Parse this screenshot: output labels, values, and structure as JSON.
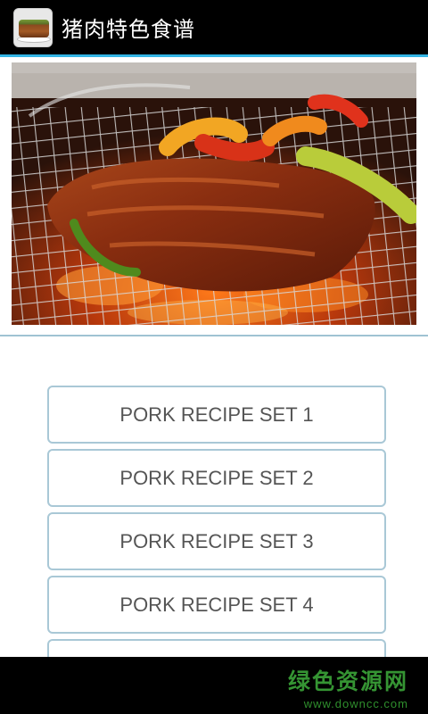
{
  "app": {
    "title": "猪肉特色食谱",
    "icon": "roast-pork-app-icon"
  },
  "hero": {
    "image": "grilled-pork-ribs-with-peppers-photo"
  },
  "recipes": [
    {
      "label": "PORK RECIPE SET 1"
    },
    {
      "label": "PORK RECIPE SET 2"
    },
    {
      "label": "PORK RECIPE SET 3"
    },
    {
      "label": "PORK RECIPE SET 4"
    },
    {
      "label": ""
    }
  ],
  "ad": {
    "brand": "绿色资源网",
    "url": "www.downcc.com"
  },
  "colors": {
    "action_bar": "#000000",
    "accent_line": "#33b5e5",
    "button_border": "#a9c8d6",
    "button_text": "#555555",
    "ad_logo": "#3fae3c"
  }
}
